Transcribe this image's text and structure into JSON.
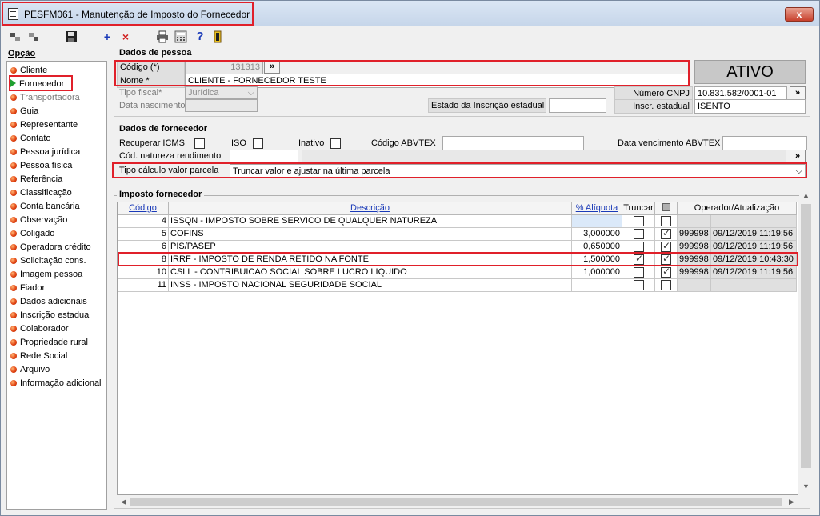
{
  "window": {
    "title": "PESFM061 - Manutenção de Imposto do Fornecedor",
    "close": "x"
  },
  "toolbar": {
    "icons": [
      "first-icon",
      "last-icon",
      "save-icon",
      "add-icon",
      "delete-icon",
      "print-icon",
      "calculator-icon",
      "help-icon",
      "exit-icon"
    ],
    "add": "+",
    "delete": "×",
    "help": "?"
  },
  "sidebar": {
    "title": "Opção",
    "items": [
      {
        "label": "Cliente",
        "disabled": false
      },
      {
        "label": "Fornecedor",
        "disabled": false,
        "active": true
      },
      {
        "label": "Transportadora",
        "disabled": true
      },
      {
        "label": "Guia",
        "disabled": false
      },
      {
        "label": "Representante",
        "disabled": false
      },
      {
        "label": "Contato",
        "disabled": false
      },
      {
        "label": "Pessoa jurídica",
        "disabled": false
      },
      {
        "label": "Pessoa física",
        "disabled": false
      },
      {
        "label": "Referência",
        "disabled": false
      },
      {
        "label": "Classificação",
        "disabled": false
      },
      {
        "label": "Conta bancária",
        "disabled": false
      },
      {
        "label": "Observação",
        "disabled": false
      },
      {
        "label": "Coligado",
        "disabled": false
      },
      {
        "label": "Operadora crédito",
        "disabled": false
      },
      {
        "label": "Solicitação cons.",
        "disabled": false
      },
      {
        "label": "Imagem pessoa",
        "disabled": false
      },
      {
        "label": "Fiador",
        "disabled": false
      },
      {
        "label": "Dados adicionais",
        "disabled": false
      },
      {
        "label": "Inscrição estadual",
        "disabled": false
      },
      {
        "label": "Colaborador",
        "disabled": false
      },
      {
        "label": "Propriedade rural",
        "disabled": false
      },
      {
        "label": "Rede Social",
        "disabled": false
      },
      {
        "label": "Arquivo",
        "disabled": false
      },
      {
        "label": "Informação adicional",
        "disabled": false
      }
    ]
  },
  "pessoa": {
    "section_title": "Dados de pessoa",
    "codigo_label": "Código (*)",
    "codigo_value": "131313",
    "lookup_btn": "»",
    "nome_label": "Nome *",
    "nome_value": "CLIENTE - FORNECEDOR TESTE",
    "tipo_fiscal_label": "Tipo fiscal*",
    "tipo_fiscal_value": "Jurídica",
    "data_nasc_label": "Data nascimento",
    "estado_ie_label": "Estado da Inscrição estadual",
    "estado_ie_value": "",
    "status": "ATIVO",
    "cnpj_label": "Número CNPJ",
    "cnpj_value": "10.831.582/0001-01",
    "ie_label": "Inscr. estadual",
    "ie_value": "ISENTO"
  },
  "fornecedor": {
    "section_title": "Dados de fornecedor",
    "recuperar_icms_label": "Recuperar ICMS",
    "recuperar_icms": false,
    "iso_label": "ISO",
    "iso": false,
    "inativo_label": "Inativo",
    "inativo": false,
    "abvtex_label": "Código ABVTEX",
    "abvtex_value": "",
    "venc_abvtex_label": "Data vencimento ABVTEX",
    "venc_abvtex_value": "",
    "natureza_label": "Cód. natureza rendimento",
    "natureza_value": "",
    "natureza_desc": "",
    "tipo_calc_label": "Tipo cálculo valor parcela",
    "tipo_calc_value": "Truncar valor e ajustar na última parcela"
  },
  "imposto": {
    "section_title": "Imposto fornecedor",
    "columns": {
      "codigo": "Código",
      "descricao": "Descrição",
      "aliquota": "% Alíquota",
      "truncar": "Truncar",
      "ativo": "",
      "operador": "Operador/Atualização"
    },
    "rows": [
      {
        "codigo": "4",
        "descricao": "ISSQN - IMPOSTO SOBRE SERVICO DE QUALQUER NATUREZA",
        "aliquota": "",
        "truncar": false,
        "ativo": false,
        "operador": "",
        "atualizacao": ""
      },
      {
        "codigo": "5",
        "descricao": "COFINS",
        "aliquota": "3,000000",
        "truncar": false,
        "ativo": true,
        "operador": "999998",
        "atualizacao": "09/12/2019 11:19:56"
      },
      {
        "codigo": "6",
        "descricao": "PIS/PASEP",
        "aliquota": "0,650000",
        "truncar": false,
        "ativo": true,
        "operador": "999998",
        "atualizacao": "09/12/2019 11:19:56"
      },
      {
        "codigo": "8",
        "descricao": "IRRF - IMPOSTO DE RENDA RETIDO NA FONTE",
        "aliquota": "1,500000",
        "truncar": true,
        "ativo": true,
        "operador": "999998",
        "atualizacao": "09/12/2019 10:43:30"
      },
      {
        "codigo": "10",
        "descricao": "CSLL - CONTRIBUICAO SOCIAL SOBRE LUCRO LIQUIDO",
        "aliquota": "1,000000",
        "truncar": false,
        "ativo": true,
        "operador": "999998",
        "atualizacao": "09/12/2019 11:19:56"
      },
      {
        "codigo": "11",
        "descricao": "INSS - IMPOSTO NACIONAL SEGURIDADE SOCIAL",
        "aliquota": "",
        "truncar": false,
        "ativo": false,
        "operador": "",
        "atualizacao": ""
      }
    ]
  },
  "colors": {
    "highlight": "#e0202a",
    "selected_row": "#dbe9f9",
    "link": "#1a3ab8"
  }
}
